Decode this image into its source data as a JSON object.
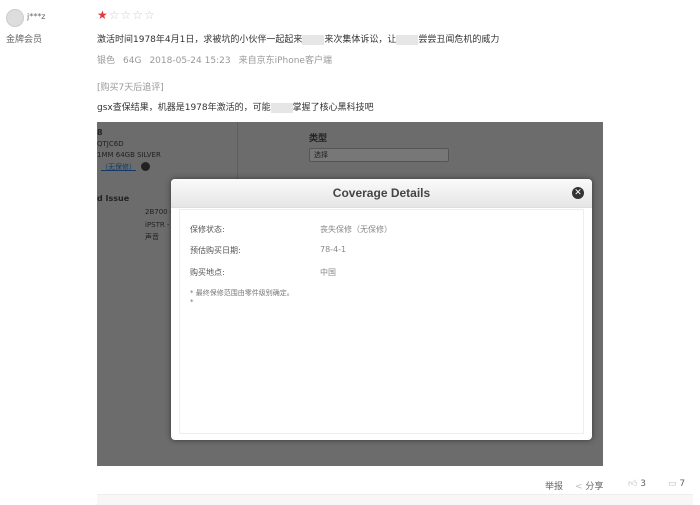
{
  "user": {
    "name": "j***z",
    "level": "金牌会员"
  },
  "rating": {
    "value": 1,
    "max": 5
  },
  "review": {
    "text_parts": [
      "激活时间1978年4月1日，求被坑的小伙伴一起起来",
      "来次集体诉讼，让",
      "尝尝丑闻危机的威力"
    ],
    "meta": {
      "color": "银色",
      "capacity": "64G",
      "date": "2018-05-24 15:23",
      "source": "来自京东iPhone客户端"
    },
    "followup_tag": "[购买7天后追评]",
    "followup_parts": [
      "gsx查保结果，机器是1978年激活的，可能",
      "掌握了核心黑科技吧"
    ]
  },
  "screenshot": {
    "bg_lines": [
      "8",
      "QTJC6D",
      "1MM 64GB SILVER",
      "（无保修）"
    ],
    "issue_title": "d Issue",
    "issue_vals": [
      "2B700 -",
      "iPSTR -",
      "声音"
    ],
    "type_label": "类型",
    "type_select": "选择",
    "modal": {
      "title": "Coverage Details",
      "rows": [
        {
          "label": "保修状态:",
          "value": "丧失保修（无保修）"
        },
        {
          "label": "预估购买日期:",
          "value": "78-4-1"
        },
        {
          "label": "购买地点:",
          "value": "中国"
        }
      ],
      "note": "* 最终保修范围由零件级别确定。",
      "note2": "*"
    }
  },
  "actions": {
    "report": "举报",
    "share": "分享",
    "likes": "3",
    "comments": "7"
  }
}
